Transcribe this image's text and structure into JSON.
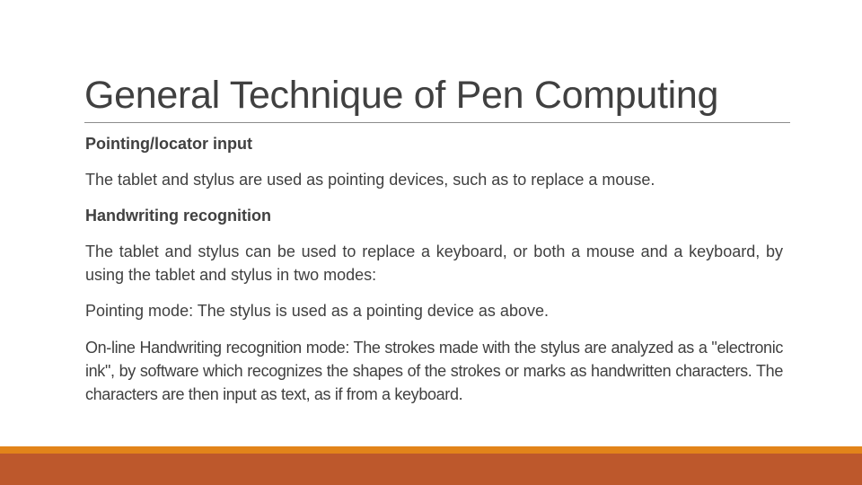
{
  "slide": {
    "title": "General Technique of Pen Computing",
    "paragraphs": [
      {
        "text": "Pointing/locator input",
        "style": "heading"
      },
      {
        "text": "The tablet and stylus are used as pointing devices, such as to replace a mouse.",
        "style": "body"
      },
      {
        "text": "Handwriting recognition",
        "style": "heading"
      },
      {
        "text": "The tablet and stylus can be used to replace a keyboard, or both a mouse and a keyboard, by using the tablet and stylus in two modes:",
        "style": "body"
      },
      {
        "text": "Pointing mode: The stylus is used as a pointing device as above.",
        "style": "body"
      },
      {
        "text": "On-line Handwriting recognition mode: The strokes made with the stylus are analyzed as a \"electronic ink\", by software which recognizes the shapes of the strokes or marks as handwritten characters. The characters are then input as text, as if from a keyboard.",
        "style": "body"
      }
    ]
  },
  "theme": {
    "text_color": "#404040",
    "rule_color": "#8c8c8c",
    "accent_bar_top": "#e2841a",
    "accent_bar_bottom": "#bd582c"
  }
}
